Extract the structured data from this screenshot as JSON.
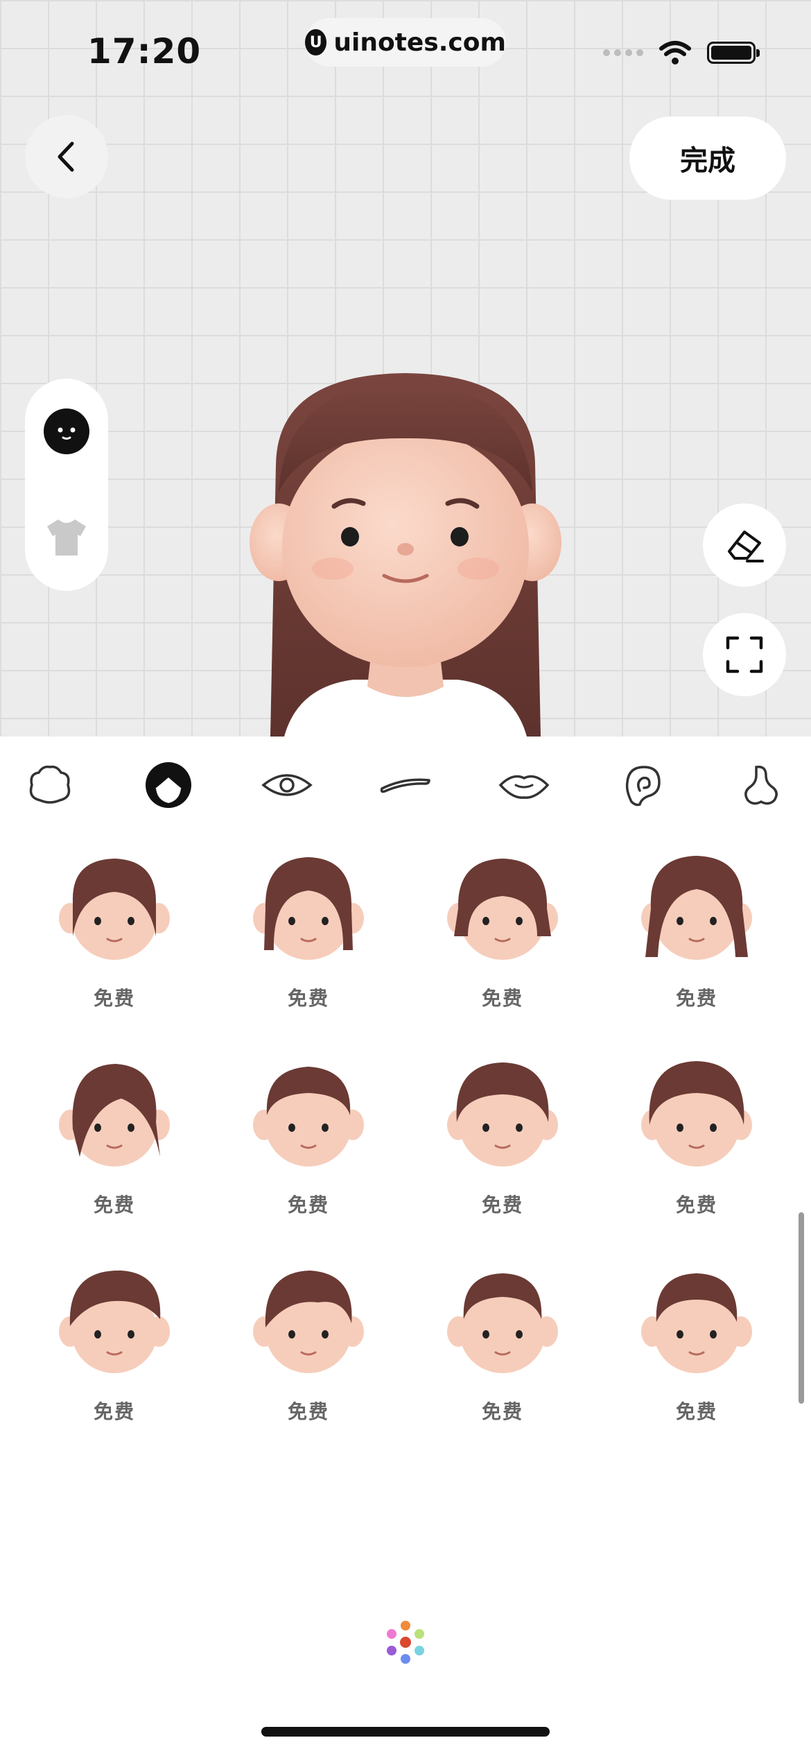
{
  "status_bar": {
    "time": "17:20",
    "url": "uinotes.com",
    "logo_letter": "U"
  },
  "header": {
    "back_icon": "chevron-left-icon",
    "done_label": "完成"
  },
  "side_tools": [
    "face-icon",
    "shirt-icon"
  ],
  "right_tools": [
    "eraser-icon",
    "fullscreen-icon"
  ],
  "tabs": [
    {
      "id": "face-shape",
      "icon": "face-shape-icon",
      "active": false
    },
    {
      "id": "hair",
      "icon": "hair-icon",
      "active": true
    },
    {
      "id": "eyes",
      "icon": "eye-icon",
      "active": false
    },
    {
      "id": "eyebrows",
      "icon": "eyebrow-icon",
      "active": false
    },
    {
      "id": "mouth",
      "icon": "mouth-icon",
      "active": false
    },
    {
      "id": "ears",
      "icon": "ear-icon",
      "active": false
    },
    {
      "id": "nose",
      "icon": "nose-icon",
      "active": false
    }
  ],
  "hair_options": [
    {
      "price": "免费"
    },
    {
      "price": "免费"
    },
    {
      "price": "免费"
    },
    {
      "price": "免费"
    },
    {
      "price": "免费"
    },
    {
      "price": "免费"
    },
    {
      "price": "免费"
    },
    {
      "price": "免费"
    },
    {
      "price": "免费"
    },
    {
      "price": "免费"
    },
    {
      "price": "免费"
    },
    {
      "price": "免费"
    }
  ],
  "colors": {
    "hair": "#6b3a34",
    "skin": "#f6cdbb",
    "accent": "#111111"
  }
}
